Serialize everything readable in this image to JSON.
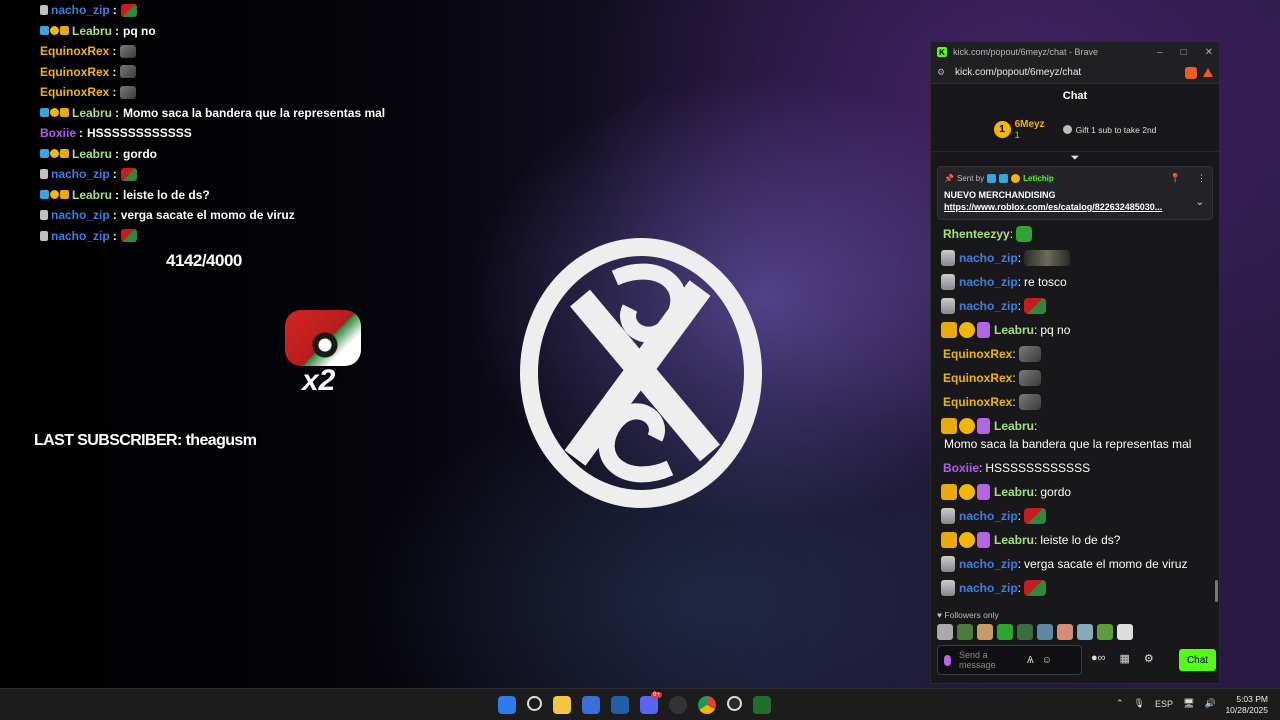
{
  "overlay": {
    "lines": [
      {
        "badges": [
          "cup"
        ],
        "name": "nacho_zip",
        "color": "#3d7fe3",
        "text": "",
        "emote": "car"
      },
      {
        "badges": [
          "cube",
          "coin",
          "crown"
        ],
        "name": "Leabru",
        "color": "#a6e07a",
        "text": "pq no",
        "emote": ""
      },
      {
        "badges": [],
        "name": "EquinoxRex",
        "color": "#f2b705",
        "text": "",
        "emote": "rock"
      },
      {
        "badges": [],
        "name": "EquinoxRex",
        "color": "#f2b705",
        "text": "",
        "emote": "rock"
      },
      {
        "badges": [],
        "name": "EquinoxRex",
        "color": "#f2b705",
        "text": "",
        "emote": "rock"
      },
      {
        "badges": [
          "cube",
          "coin",
          "crown"
        ],
        "name": "Leabru",
        "color": "#a6e07a",
        "text": "Momo saca la bandera que la representas mal",
        "emote": ""
      },
      {
        "badges": [],
        "name": "Boxiie",
        "color": "#b45cf0",
        "text": "HSSSSSSSSSSSS",
        "emote": ""
      },
      {
        "badges": [
          "cube",
          "coin",
          "crown"
        ],
        "name": "Leabru",
        "color": "#a6e07a",
        "text": "gordo",
        "emote": ""
      },
      {
        "badges": [
          "cup"
        ],
        "name": "nacho_zip",
        "color": "#3d7fe3",
        "text": "",
        "emote": "car"
      },
      {
        "badges": [
          "cube",
          "coin",
          "crown"
        ],
        "name": "Leabru",
        "color": "#a6e07a",
        "text": "leiste lo de ds?",
        "emote": ""
      },
      {
        "badges": [
          "cup"
        ],
        "name": "nacho_zip",
        "color": "#3d7fe3",
        "text": "verga sacate el momo de viruz",
        "emote": ""
      },
      {
        "badges": [
          "cup"
        ],
        "name": "nacho_zip",
        "color": "#3d7fe3",
        "text": "",
        "emote": "car"
      }
    ],
    "separator": ":",
    "counter": "4142/4000",
    "multiplier": "x2",
    "last_subscriber": "LAST SUBSCRIBER: theagusm"
  },
  "window": {
    "title": "kick.com/popout/6meyz/chat - Brave",
    "url": "kick.com/popout/6meyz/chat",
    "controls": [
      "–",
      "□",
      "✕"
    ]
  },
  "chat": {
    "title": "Chat",
    "top_gifter": {
      "rank": "1",
      "name": "6Meyz",
      "count": "1"
    },
    "gift_cta": "Gift 1 sub to take 2nd",
    "pinned": {
      "sent_by_label": "Sent by",
      "user": "Letichip",
      "title": "NUEVO MERCHANDISING",
      "link": "https://www.roblox.com/es/catalog/822632485030..."
    },
    "messages": [
      {
        "badges": [],
        "name": "Rhenteezyy",
        "color": "#a6e07a",
        "text": "",
        "emote": "green"
      },
      {
        "badges": [
          "cup"
        ],
        "name": "nacho_zip",
        "color": "#3d7fe3",
        "text": "",
        "emote": "wide"
      },
      {
        "badges": [
          "cup"
        ],
        "name": "nacho_zip",
        "color": "#3d7fe3",
        "text": "re tosco",
        "emote": ""
      },
      {
        "badges": [
          "cup"
        ],
        "name": "nacho_zip",
        "color": "#3d7fe3",
        "text": "",
        "emote": "car"
      },
      {
        "badges": [
          "crown",
          "coin",
          "gift"
        ],
        "name": "Leabru",
        "color": "#a6e07a",
        "text": "pq no",
        "emote": ""
      },
      {
        "badges": [],
        "name": "EquinoxRex",
        "color": "#f2b705",
        "text": "",
        "emote": "rock"
      },
      {
        "badges": [],
        "name": "EquinoxRex",
        "color": "#f2b705",
        "text": "",
        "emote": "rock"
      },
      {
        "badges": [],
        "name": "EquinoxRex",
        "color": "#f2b705",
        "text": "",
        "emote": "rock"
      },
      {
        "badges": [
          "crown",
          "coin",
          "gift"
        ],
        "name": "Leabru",
        "color": "#a6e07a",
        "text": "Momo saca la bandera que la representas mal",
        "emote": ""
      },
      {
        "badges": [],
        "name": "Boxiie",
        "color": "#b45cf0",
        "text": "HSSSSSSSSSSSS",
        "emote": ""
      },
      {
        "badges": [
          "crown",
          "coin",
          "gift"
        ],
        "name": "Leabru",
        "color": "#a6e07a",
        "text": "gordo",
        "emote": ""
      },
      {
        "badges": [
          "cup"
        ],
        "name": "nacho_zip",
        "color": "#3d7fe3",
        "text": "",
        "emote": "car"
      },
      {
        "badges": [
          "crown",
          "coin",
          "gift"
        ],
        "name": "Leabru",
        "color": "#a6e07a",
        "text": "leiste lo de ds?",
        "emote": ""
      },
      {
        "badges": [
          "cup"
        ],
        "name": "nacho_zip",
        "color": "#3d7fe3",
        "text": "verga sacate el momo de viruz",
        "emote": ""
      },
      {
        "badges": [
          "cup"
        ],
        "name": "nacho_zip",
        "color": "#3d7fe3",
        "text": "",
        "emote": "car"
      }
    ],
    "separator": ":",
    "followers_only": "Followers only",
    "composer_placeholder": "Send a message",
    "send_label": "Chat"
  },
  "taskbar": {
    "discord_badge": "9+",
    "language": "ESP",
    "time": "5:03 PM",
    "date": "10/28/2025"
  },
  "colors": {
    "kick_green": "#53fc18",
    "gold": "#f2b705"
  }
}
